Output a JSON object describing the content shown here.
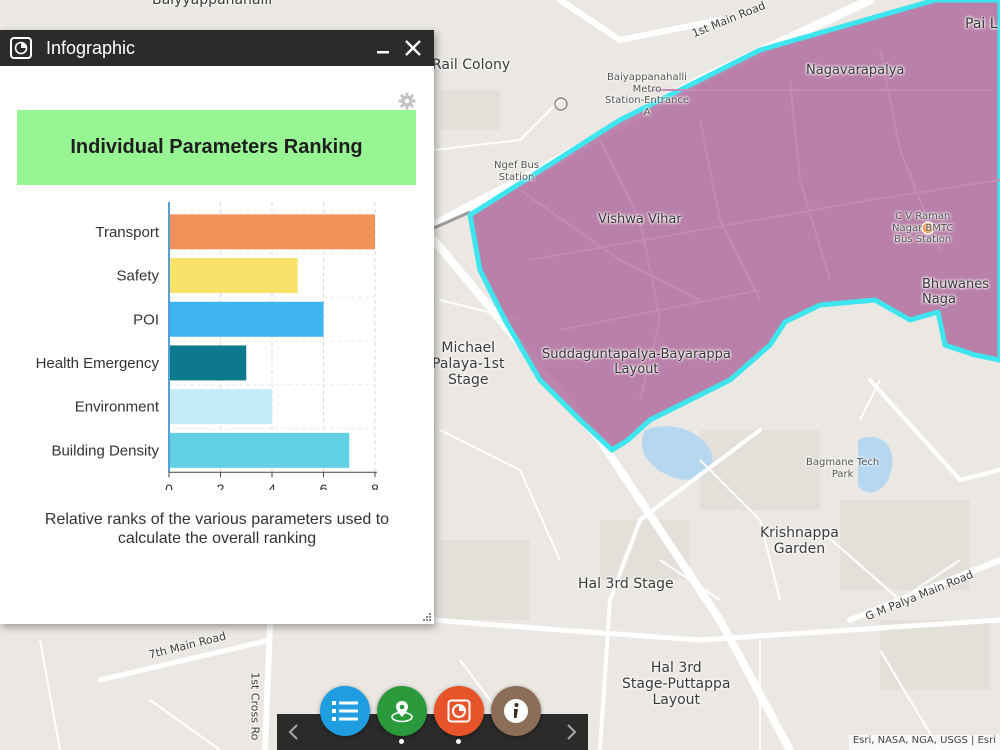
{
  "map": {
    "labels": [
      {
        "text": "Baiyyappanahalli",
        "cls": "lbl-lg"
      },
      {
        "text": "Pai L",
        "cls": "lbl-lg"
      },
      {
        "text": "1st Main Road",
        "cls": "lbl-road"
      },
      {
        "text": "Rail Colony",
        "cls": "lbl-lg"
      },
      {
        "text": "Baiyappanahalli\nMetro\nStation-Entrance\nA",
        "cls": "lbl-sm"
      },
      {
        "text": "Nagavarapalya",
        "cls": "lbl-md"
      },
      {
        "text": "Ngef Bus\nStation",
        "cls": "lbl-sm"
      },
      {
        "text": "Vishwa Vihar",
        "cls": "lbl-md"
      },
      {
        "text": "C V Raman\nNagar BMTC\nBus Station",
        "cls": "lbl-sm"
      },
      {
        "text": "Bhuwanes\nNaga",
        "cls": "lbl-md"
      },
      {
        "text": "Michael\nPalaya-1st\nStage",
        "cls": "lbl-lg"
      },
      {
        "text": "Suddaguntapalya-Bayarappa\nLayout",
        "cls": "lbl-md"
      },
      {
        "text": "Bagmane Tech\nPark",
        "cls": "lbl-sm"
      },
      {
        "text": "Krishnappa\nGarden",
        "cls": "lbl-lg"
      },
      {
        "text": "G M Palya Main Road",
        "cls": "lbl-road"
      },
      {
        "text": "Hal 3rd Stage",
        "cls": "lbl-lg"
      },
      {
        "text": "7th Main Road",
        "cls": "lbl-road"
      },
      {
        "text": "1st Cross Ro",
        "cls": "lbl-road"
      },
      {
        "text": "Hal 3rd\nStage-Puttappa\nLayout",
        "cls": "lbl-lg"
      }
    ],
    "attribution": "Esri, NASA, NGA, USGS | Esri"
  },
  "panel": {
    "title": "Infographic",
    "minimize_icon": "minimize-icon",
    "close_icon": "close-icon",
    "settings_icon": "gear-icon",
    "chart_title": "Individual Parameters Ranking",
    "caption": "Relative ranks of the various parameters used to calculate the overall ranking",
    "title_bg": "#98f593"
  },
  "chart_data": {
    "type": "bar",
    "orientation": "horizontal",
    "title": "Individual Parameters Ranking",
    "categories": [
      "Transport",
      "Safety",
      "POI",
      "Health Emergency",
      "Environment",
      "Building Density"
    ],
    "values": [
      8,
      5,
      6,
      3,
      4,
      7
    ],
    "colors": [
      "#f0925a",
      "#f9e26a",
      "#3eb4f0",
      "#0c7a8c",
      "#c5ecf6",
      "#62d1e3"
    ],
    "xticks": [
      0,
      2,
      4,
      6,
      8
    ],
    "xlim": [
      0,
      8
    ],
    "grid": true
  },
  "toolbar": {
    "prev_icon": "chevron-left-icon",
    "next_icon": "chevron-right-icon",
    "buttons": [
      {
        "icon": "layer-list-icon",
        "color": "#1e9de0"
      },
      {
        "icon": "map-pin-icon",
        "color": "#2a9a3c"
      },
      {
        "icon": "infographic-icon",
        "color": "#e8542a"
      },
      {
        "icon": "info-icon",
        "color": "#8c6e58"
      }
    ]
  }
}
